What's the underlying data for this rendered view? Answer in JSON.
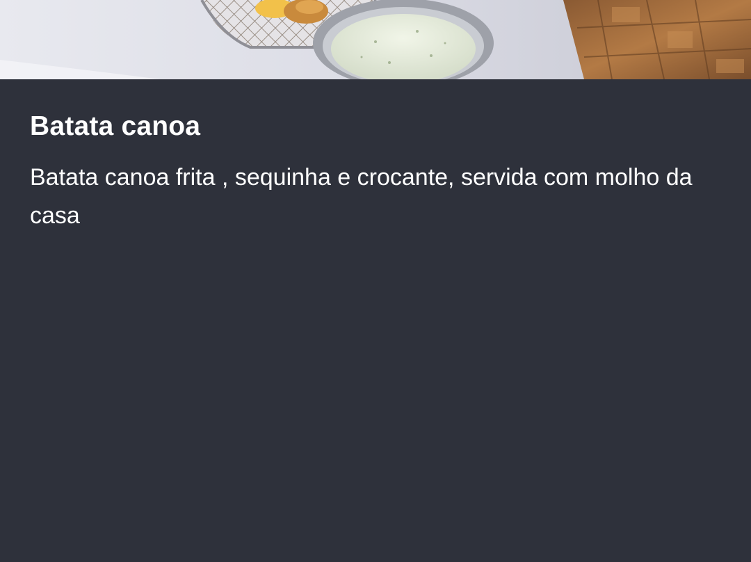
{
  "product": {
    "photo_alt": "batata-canoa-photo",
    "title": "Batata canoa",
    "description": "Batata canoa frita , sequinha e crocante, servida com molho da casa"
  },
  "colors": {
    "background": "#2e313b",
    "text": "#ffffff"
  }
}
